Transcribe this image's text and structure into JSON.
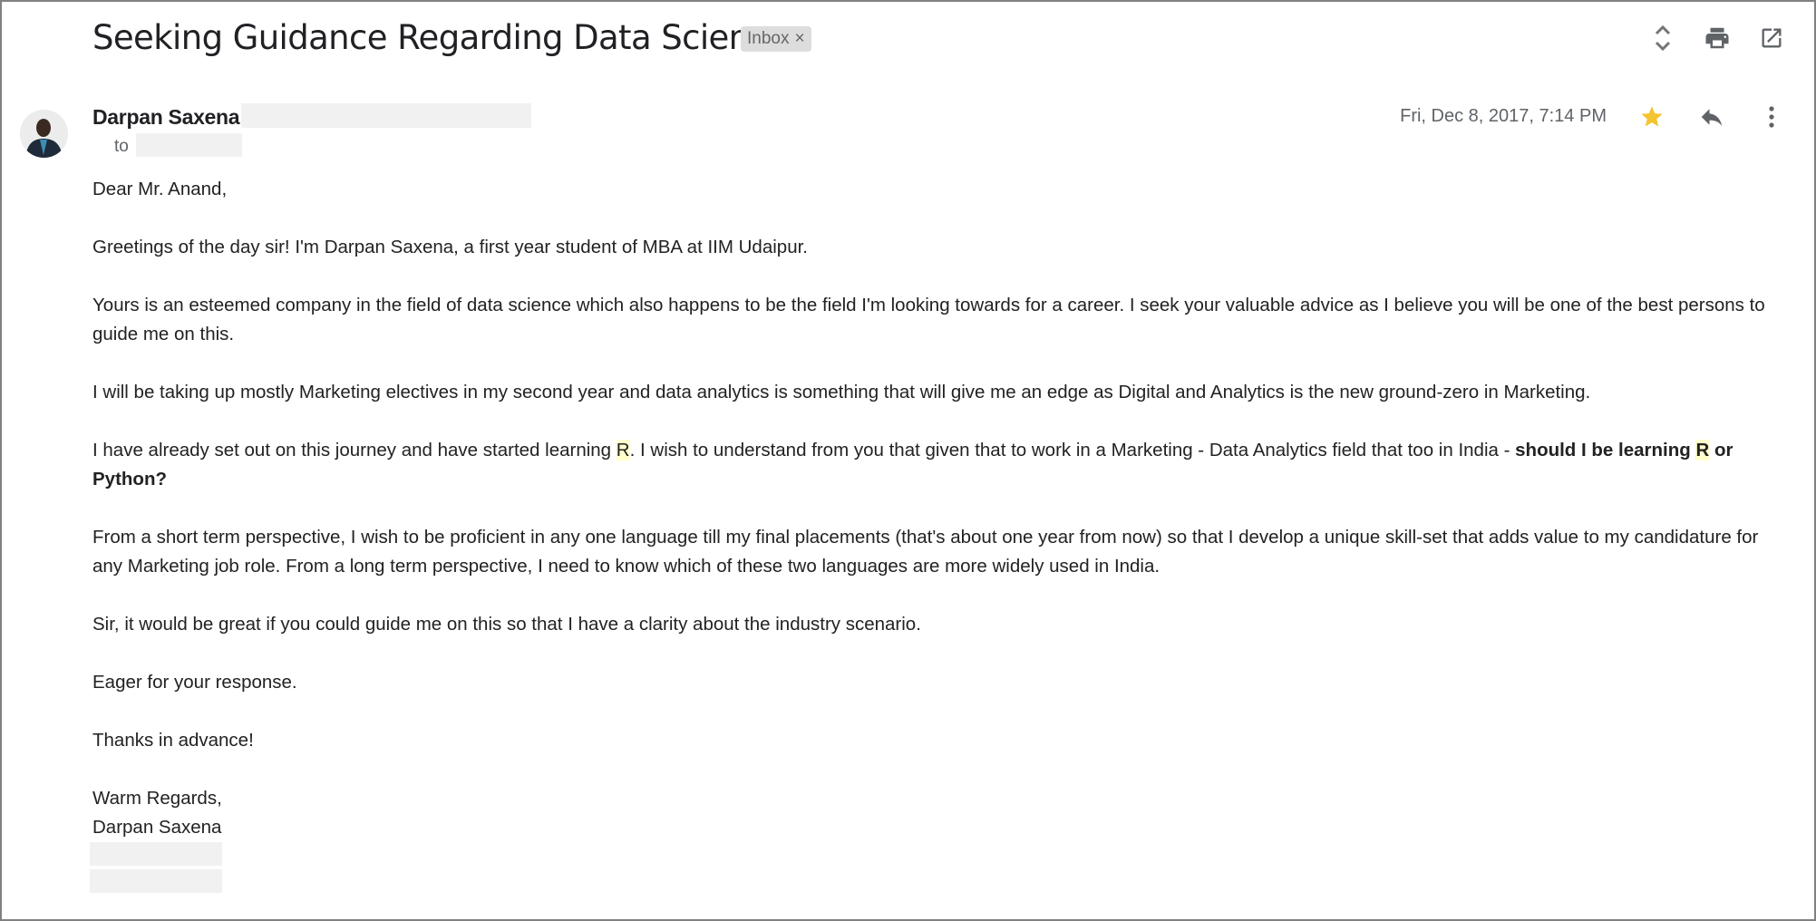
{
  "email": {
    "subject": "Seeking Guidance Regarding Data Science",
    "label": "Inbox",
    "label_remove_symbol": "×",
    "sender_name": "Darpan Saxena",
    "to_label": "to",
    "date": "Fri, Dec 8, 2017, 7:14 PM",
    "starred": true,
    "colors": {
      "star": "#f4c430",
      "highlight": "#ffffcc",
      "icon": "#5f6368"
    }
  },
  "toolbar": {
    "icons": [
      "expand-collapse-icon",
      "print-icon",
      "open-in-new-window-icon"
    ]
  },
  "actions": {
    "icons": [
      "star-icon",
      "reply-icon",
      "more-options-icon"
    ]
  },
  "body": {
    "greeting": "Dear Mr. Anand,",
    "p1": "Greetings of the day sir! I'm Darpan Saxena, a first year student of MBA at IIM Udaipur.",
    "p2": "Yours is an esteemed company in the field of data science which also happens to be the field I'm looking towards for a career. I seek your valuable advice as I believe you will be one of the best persons to guide me on this.",
    "p3": "I will be taking up mostly Marketing electives in my second year and data analytics is something that will give me an edge as Digital and Analytics is the new ground-zero in Marketing.",
    "p4_a": "I have already set out on this journey and have started learning ",
    "p4_r": "R",
    "p4_b": ". I wish to understand from you that given that to work in a Marketing - Data Analytics field that too in India - ",
    "p4_bold_a": "should I be learning ",
    "p4_bold_r": "R",
    "p4_bold_b": " or Python?",
    "p5": "From a short term perspective, I wish to be proficient in any one language till my final placements (that's about one year from now) so that I develop a unique skill-set that adds value to my candidature for any Marketing job role. From a long term perspective, I need to know which of these two languages are more widely used in  India.",
    "p6": "Sir, it would be great if you could guide me on this so that I have a clarity about the industry scenario.",
    "p7": "Eager for your response.",
    "p8": "Thanks in advance!",
    "closing": "Warm Regards,",
    "signature_name": "Darpan Saxena"
  }
}
